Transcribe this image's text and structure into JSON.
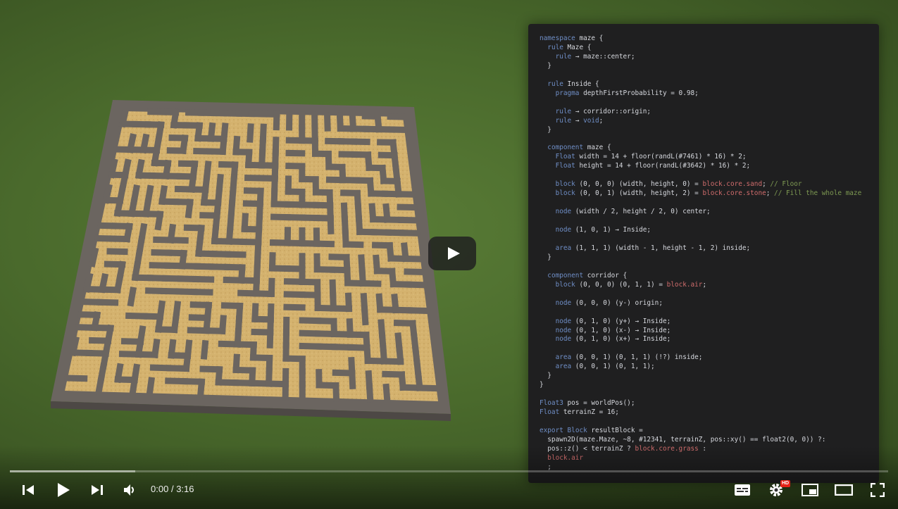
{
  "player": {
    "current_time": "0:00",
    "duration": "3:16",
    "time_separator": "/",
    "loaded_fraction": 0.143,
    "hd_badge": "HD",
    "icons": [
      "skip-previous-icon",
      "play-icon",
      "skip-next-icon",
      "volume-icon",
      "subtitles-icon",
      "settings-icon",
      "miniplayer-icon",
      "theater-mode-icon",
      "fullscreen-icon",
      "big-play-icon"
    ]
  },
  "colors": {
    "grass": "#4e6f30",
    "maze_wall": "#6b6560",
    "maze_floor": "#d4b26e",
    "code_bg": "#1f1f20",
    "keyword": "#6f8ec6",
    "string_block": "#d06c6c",
    "comment": "#7e9a52",
    "hd_red": "#e62117"
  },
  "code": {
    "lines": [
      [
        [
          "kw",
          "namespace"
        ],
        [
          "t",
          " maze {"
        ]
      ],
      [
        [
          "t",
          "  "
        ],
        [
          "kw",
          "rule"
        ],
        [
          "t",
          " Maze {"
        ]
      ],
      [
        [
          "t",
          "    "
        ],
        [
          "kw",
          "rule"
        ],
        [
          "t",
          " → maze::center;"
        ]
      ],
      [
        [
          "t",
          "  }"
        ]
      ],
      [
        [
          "t",
          ""
        ]
      ],
      [
        [
          "t",
          "  "
        ],
        [
          "kw",
          "rule"
        ],
        [
          "t",
          " Inside {"
        ]
      ],
      [
        [
          "t",
          "    "
        ],
        [
          "kw",
          "pragma"
        ],
        [
          "t",
          " depthFirstProbability = 0.98;"
        ]
      ],
      [
        [
          "t",
          ""
        ]
      ],
      [
        [
          "t",
          "    "
        ],
        [
          "kw",
          "rule"
        ],
        [
          "t",
          " → corridor::origin;"
        ]
      ],
      [
        [
          "t",
          "    "
        ],
        [
          "kw",
          "rule"
        ],
        [
          "t",
          " → "
        ],
        [
          "kw",
          "void"
        ],
        [
          "t",
          ";"
        ]
      ],
      [
        [
          "t",
          "  }"
        ]
      ],
      [
        [
          "t",
          ""
        ]
      ],
      [
        [
          "t",
          "  "
        ],
        [
          "kw",
          "component"
        ],
        [
          "t",
          " maze {"
        ]
      ],
      [
        [
          "t",
          "    "
        ],
        [
          "kw",
          "Float"
        ],
        [
          "t",
          " width = 14 + floor(randL(#7461) * 16) * 2;"
        ]
      ],
      [
        [
          "t",
          "    "
        ],
        [
          "kw",
          "Float"
        ],
        [
          "t",
          " height = 14 + floor(randL(#3642) * 16) * 2;"
        ]
      ],
      [
        [
          "t",
          ""
        ]
      ],
      [
        [
          "t",
          "    "
        ],
        [
          "kw",
          "block"
        ],
        [
          "t",
          " (0, 0, 0) (width, height, 0) = "
        ],
        [
          "str",
          "block.core.sand"
        ],
        [
          "t",
          "; "
        ],
        [
          "cm",
          "// Floor"
        ]
      ],
      [
        [
          "t",
          "    "
        ],
        [
          "kw",
          "block"
        ],
        [
          "t",
          " (0, 0, 1) (width, height, 2) = "
        ],
        [
          "str",
          "block.core.stone"
        ],
        [
          "t",
          "; "
        ],
        [
          "cm",
          "// Fill the whole maze"
        ]
      ],
      [
        [
          "t",
          ""
        ]
      ],
      [
        [
          "t",
          "    "
        ],
        [
          "kw",
          "node"
        ],
        [
          "t",
          " (width / 2, height / 2, 0) center;"
        ]
      ],
      [
        [
          "t",
          ""
        ]
      ],
      [
        [
          "t",
          "    "
        ],
        [
          "kw",
          "node"
        ],
        [
          "t",
          " (1, 0, 1) → Inside;"
        ]
      ],
      [
        [
          "t",
          ""
        ]
      ],
      [
        [
          "t",
          "    "
        ],
        [
          "kw",
          "area"
        ],
        [
          "t",
          " (1, 1, 1) (width - 1, height - 1, 2) inside;"
        ]
      ],
      [
        [
          "t",
          "  }"
        ]
      ],
      [
        [
          "t",
          ""
        ]
      ],
      [
        [
          "t",
          "  "
        ],
        [
          "kw",
          "component"
        ],
        [
          "t",
          " corridor {"
        ]
      ],
      [
        [
          "t",
          "    "
        ],
        [
          "kw",
          "block"
        ],
        [
          "t",
          " (0, 0, 0) (0, 1, 1) = "
        ],
        [
          "str",
          "block.air"
        ],
        [
          "t",
          ";"
        ]
      ],
      [
        [
          "t",
          ""
        ]
      ],
      [
        [
          "t",
          "    "
        ],
        [
          "kw",
          "node"
        ],
        [
          "t",
          " (0, 0, 0) (y-) origin;"
        ]
      ],
      [
        [
          "t",
          ""
        ]
      ],
      [
        [
          "t",
          "    "
        ],
        [
          "kw",
          "node"
        ],
        [
          "t",
          " (0, 1, 0) (y+) → Inside;"
        ]
      ],
      [
        [
          "t",
          "    "
        ],
        [
          "kw",
          "node"
        ],
        [
          "t",
          " (0, 1, 0) (x-) → Inside;"
        ]
      ],
      [
        [
          "t",
          "    "
        ],
        [
          "kw",
          "node"
        ],
        [
          "t",
          " (0, 1, 0) (x+) → Inside;"
        ]
      ],
      [
        [
          "t",
          ""
        ]
      ],
      [
        [
          "t",
          "    "
        ],
        [
          "kw",
          "area"
        ],
        [
          "t",
          " (0, 0, 1) (0, 1, 1) (!?) inside;"
        ]
      ],
      [
        [
          "t",
          "    "
        ],
        [
          "kw",
          "area"
        ],
        [
          "t",
          " (0, 0, 1) (0, 1, 1);"
        ]
      ],
      [
        [
          "t",
          "  }"
        ]
      ],
      [
        [
          "t",
          "}"
        ]
      ],
      [
        [
          "t",
          ""
        ]
      ],
      [
        [
          "kw",
          "Float3"
        ],
        [
          "t",
          " pos = worldPos();"
        ]
      ],
      [
        [
          "kw",
          "Float"
        ],
        [
          "t",
          " terrainZ = 16;"
        ]
      ],
      [
        [
          "t",
          ""
        ]
      ],
      [
        [
          "kw",
          "export"
        ],
        [
          "t",
          " "
        ],
        [
          "kw",
          "Block"
        ],
        [
          "t",
          " resultBlock ="
        ]
      ],
      [
        [
          "t",
          "  spawn2D(maze.Maze, ~8, #12341, terrainZ, pos::xy() == float2(0, 0)) ?:"
        ]
      ],
      [
        [
          "t",
          "  pos::z() < terrainZ ? "
        ],
        [
          "str",
          "block.core.grass"
        ],
        [
          "t",
          " :"
        ]
      ],
      [
        [
          "t",
          "  "
        ],
        [
          "str",
          "block.air"
        ]
      ],
      [
        [
          "t",
          "  ;"
        ]
      ]
    ]
  }
}
